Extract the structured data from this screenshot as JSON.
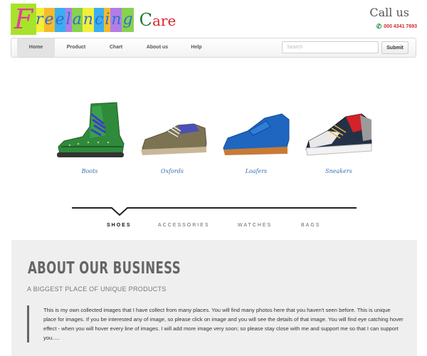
{
  "header": {
    "logo": {
      "big_letter": "F",
      "letters": [
        "r",
        "e",
        "e",
        "l",
        "a",
        "n",
        "c",
        "i",
        "n",
        "g"
      ],
      "care_first": "C",
      "care_rest": "are"
    },
    "call_us": "Call us",
    "phone": "000 4341 7693"
  },
  "nav": {
    "items": [
      "Home",
      "Product",
      "Chart",
      "About us",
      "Help"
    ],
    "active": "Home",
    "search_placeholder": "Search",
    "submit_label": "Submit"
  },
  "products": [
    {
      "label": "Boots",
      "icon": "boot-icon"
    },
    {
      "label": "Oxfords",
      "icon": "oxford-shoe-icon"
    },
    {
      "label": "Loafers",
      "icon": "loafer-icon"
    },
    {
      "label": "Sneakers",
      "icon": "sneaker-icon"
    }
  ],
  "tabs": {
    "items": [
      "SHOES",
      "ACCESSORIES",
      "WATCHES",
      "BAGS"
    ],
    "active": "SHOES"
  },
  "about": {
    "title": "ABOUT OUR BUSINESS",
    "subtitle": "A BIGGEST PLACE OF UNIQUE PRODUCTS",
    "text": "This is my own collected images that I have collect from many places. You will find many photos here that you haven't seen before. This is unique place for images. If you be interested any of image, so please click on image and you will see the details of that image. You will find eye catching hover effect - when you will hover every line of images. I will add more image very soon; so please stay close with me and support me so that I can support you....."
  }
}
